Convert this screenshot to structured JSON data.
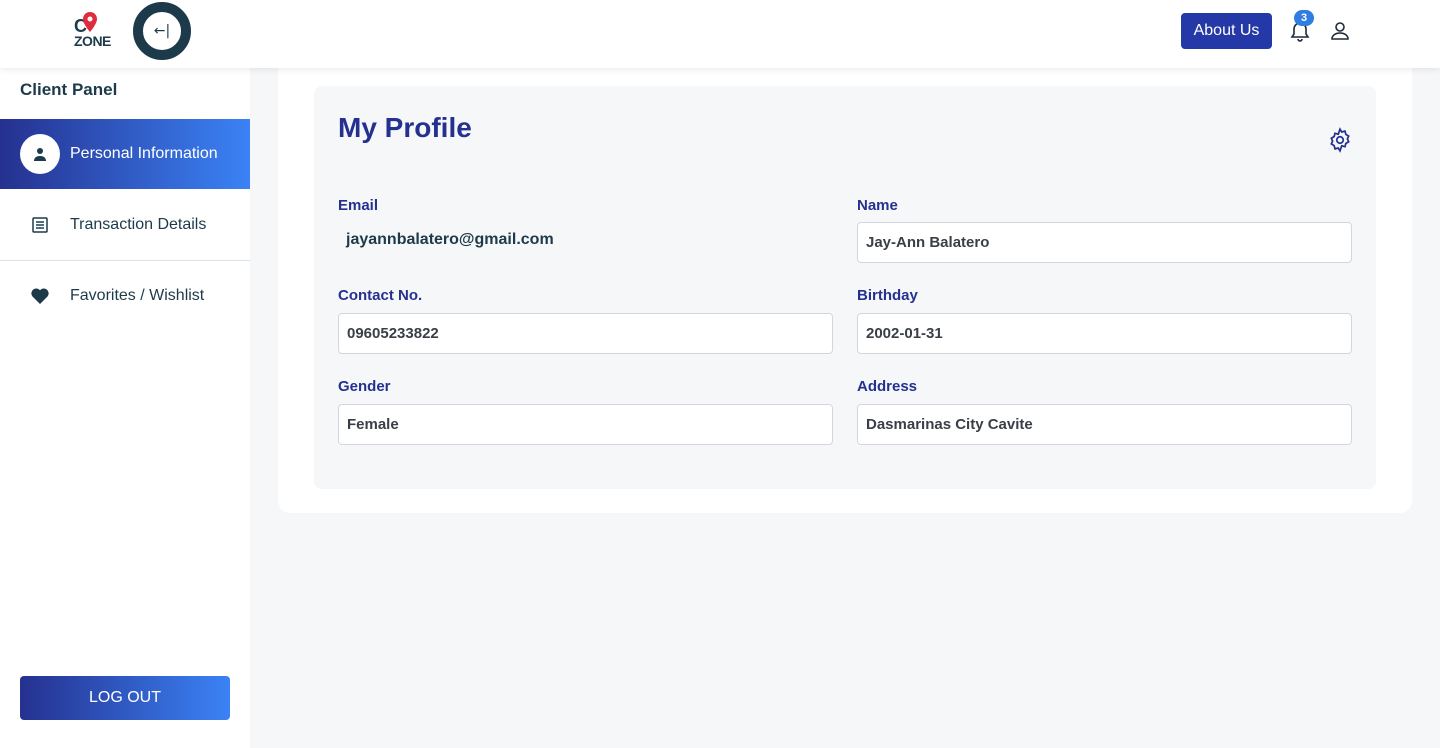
{
  "header": {
    "logo_text_top": "C",
    "logo_text_bottom": "ZONE",
    "collapse_glyph": "←|",
    "about_label": "About Us",
    "notification_count": "3"
  },
  "sidebar": {
    "title": "Client Panel",
    "items": [
      {
        "label": "Personal Information",
        "icon": "person-icon",
        "active": true
      },
      {
        "label": "Transaction Details",
        "icon": "receipt-icon",
        "active": false
      },
      {
        "label": "Favorites / Wishlist",
        "icon": "heart-icon",
        "active": false
      }
    ],
    "logout_label": "LOG OUT"
  },
  "profile": {
    "title": "My Profile",
    "email_label": "Email",
    "email_value": "jayannbalatero@gmail.com",
    "name_label": "Name",
    "name_value": "Jay-Ann Balatero",
    "contact_label": "Contact No.",
    "contact_value": "09605233822",
    "birthday_label": "Birthday",
    "birthday_value": "2002-01-31",
    "gender_label": "Gender",
    "gender_value": "Female",
    "address_label": "Address",
    "address_value": "Dasmarinas City Cavite"
  },
  "colors": {
    "primary": "#25318f",
    "accent": "#3b82f6",
    "dark": "#1d3a4a",
    "logo_pin": "#e02b3c"
  }
}
